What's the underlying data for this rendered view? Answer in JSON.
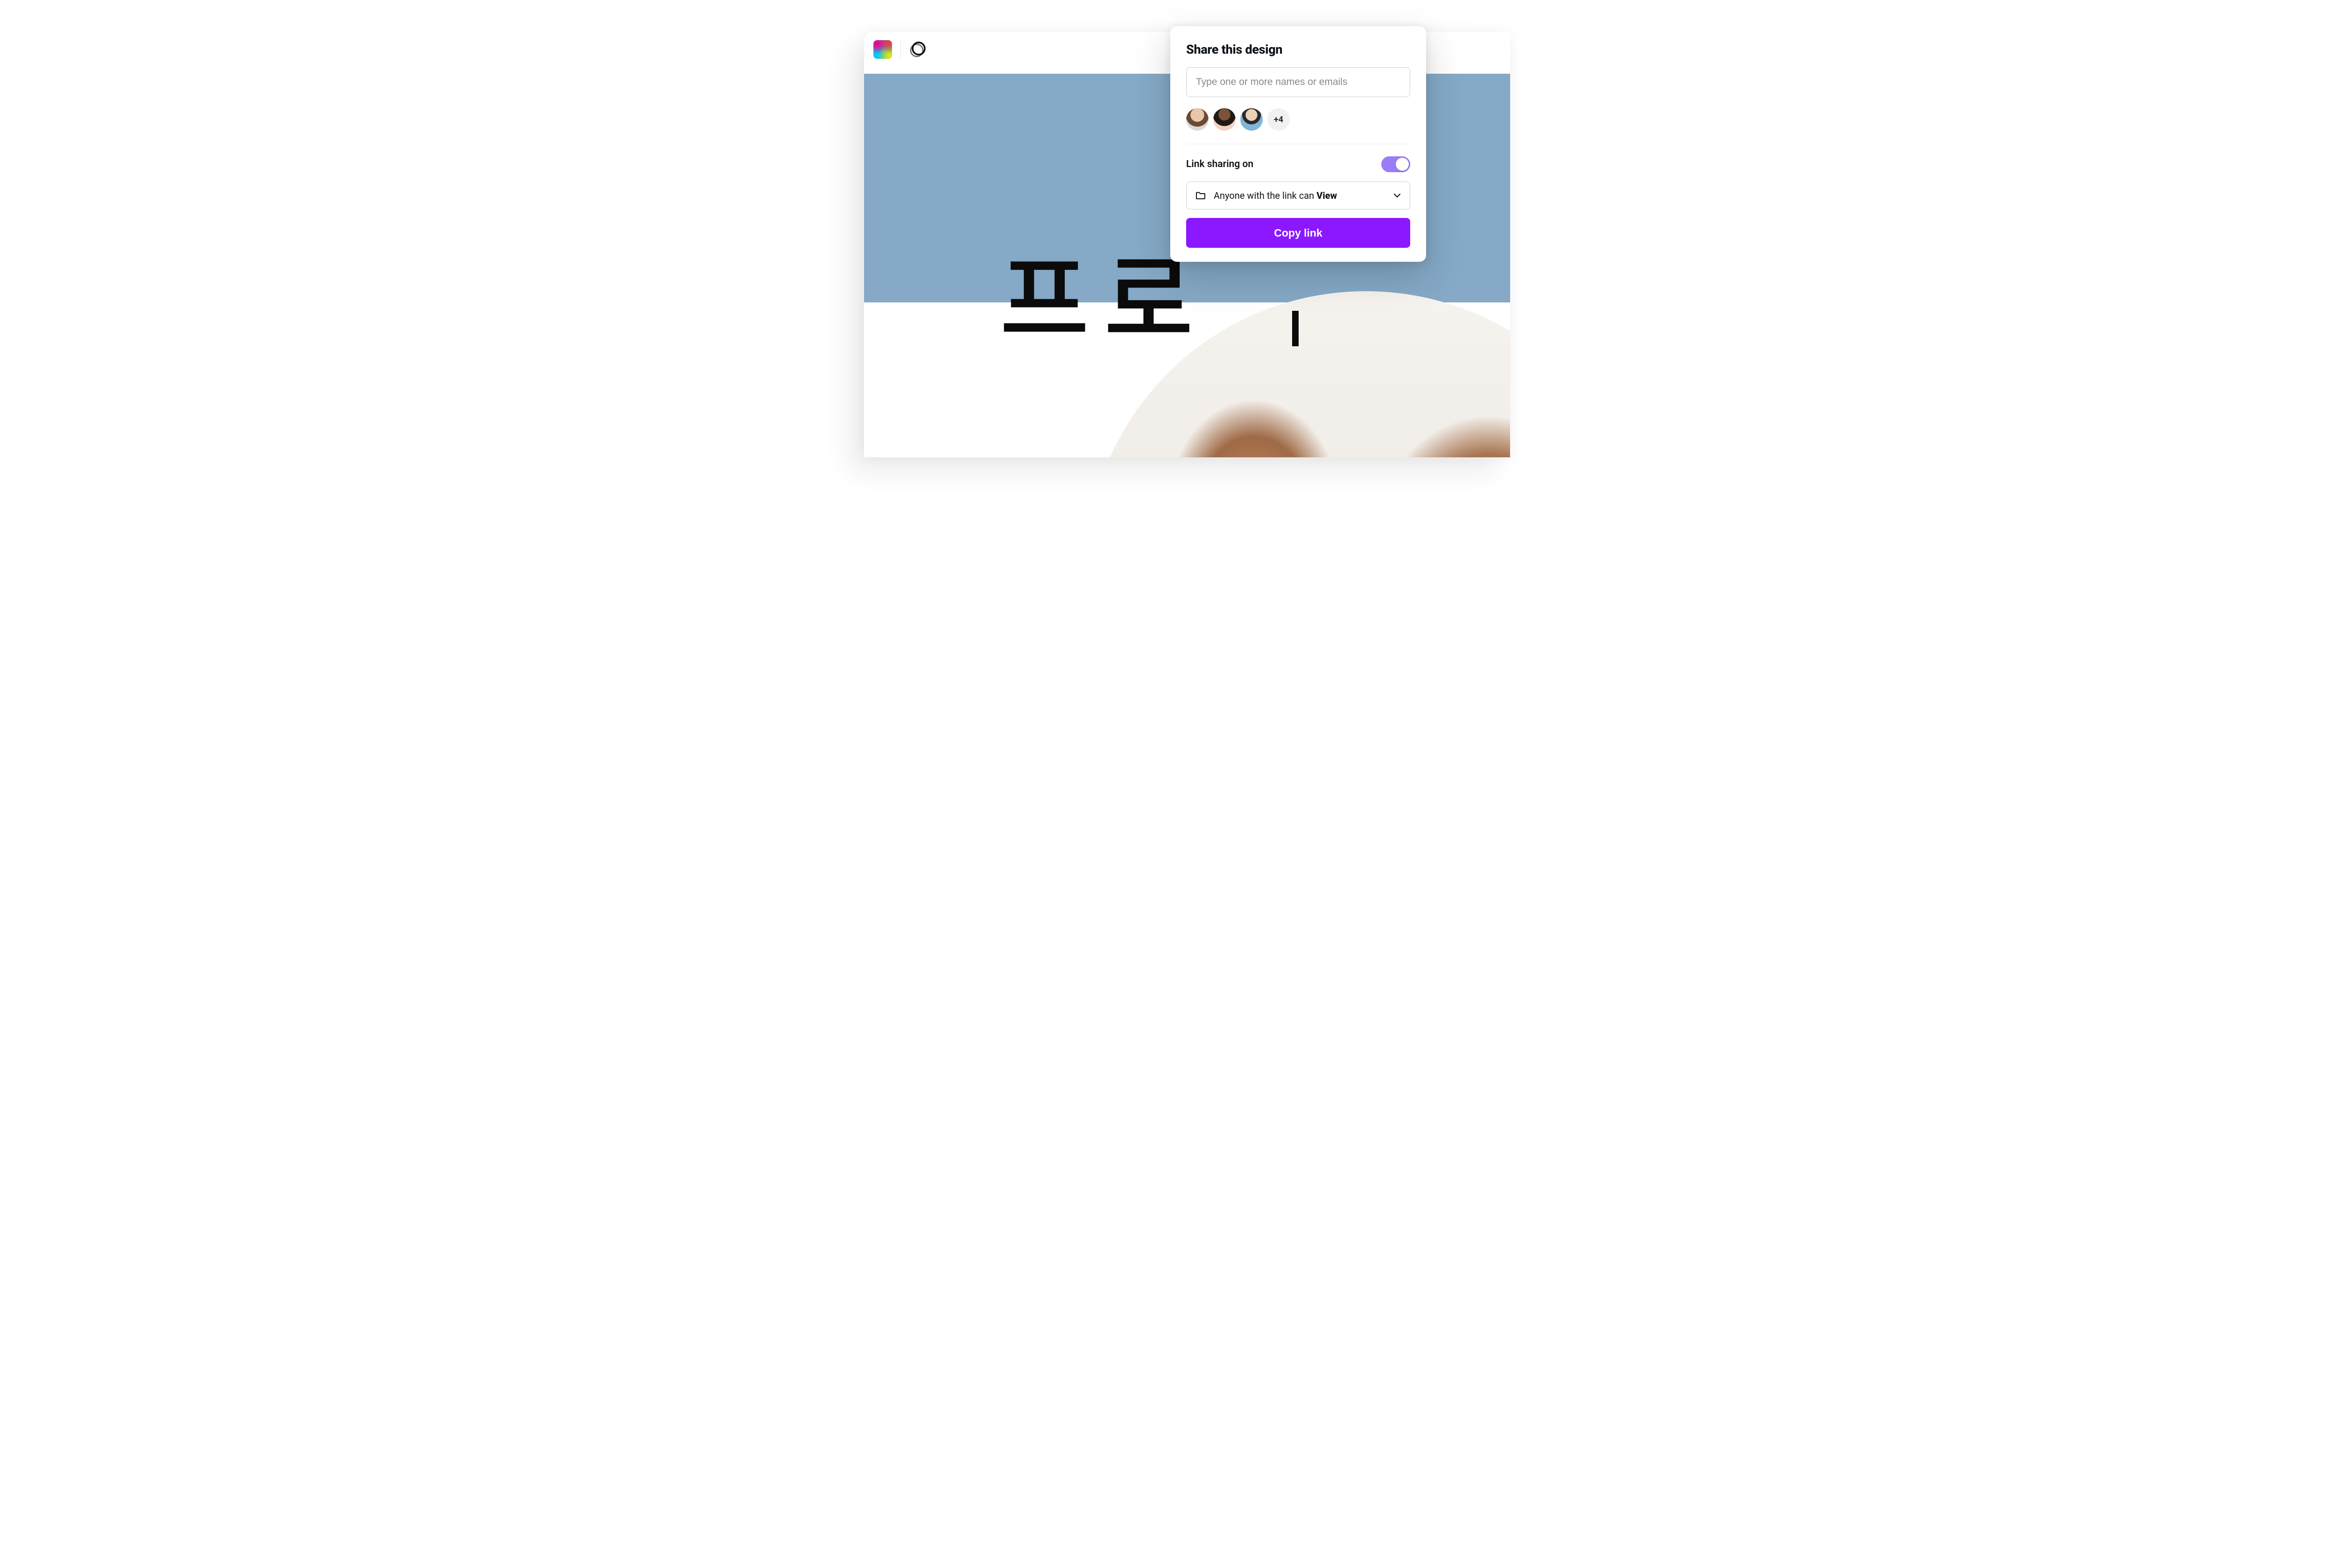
{
  "canvas": {
    "text": "프로",
    "bg_color": "#85a9c6"
  },
  "share": {
    "title": "Share this design",
    "input_placeholder": "Type one or more names or emails",
    "more_count": "+4",
    "link_sharing_label": "Link sharing on",
    "link_sharing_on": true,
    "permission_prefix": "Anyone with the link can ",
    "permission_role": "View",
    "copy_button": "Copy link"
  },
  "colors": {
    "accent": "#8b18ff",
    "toggle": "#9b7cf6"
  }
}
